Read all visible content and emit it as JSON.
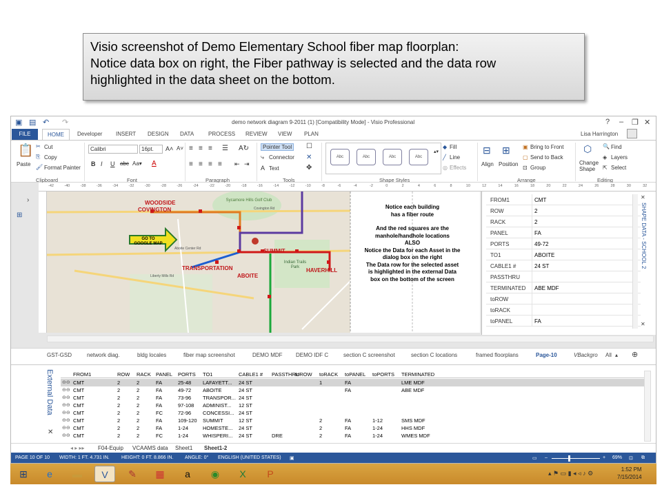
{
  "caption": {
    "line1": "Visio screenshot of Demo Elementary School fiber map floorplan:",
    "line2": "Notice data box on right, the Fiber pathway is selected and the data row",
    "line3": "highlighted in the data sheet on the bottom."
  },
  "titlebar": {
    "title": "demo network diagram 9-2011 (1)  [Compatibility Mode] - Visio Professional",
    "help": "?"
  },
  "tabs": [
    "Developer",
    "INSERT",
    "DESIGN",
    "DATA",
    "PROCESS",
    "REVIEW",
    "VIEW",
    "PLAN"
  ],
  "tab_file": "FILE",
  "tab_home": "HOME",
  "user": "Lisa Harrington",
  "ribbon": {
    "paste": "Paste",
    "cut": "Cut",
    "copy": "Copy",
    "format_painter": "Format Painter",
    "clipboard_label": "Clipboard",
    "font_name": "Calibri",
    "font_size": "16pt.",
    "font_label": "Font",
    "paragraph_label": "Paragraph",
    "pointer_tool": "Pointer Tool",
    "connector": "Connector",
    "text": "Text",
    "tools_label": "Tools",
    "shape_style_sample": "Abc",
    "fill": "Fill",
    "line": "Line",
    "effects": "Effects",
    "shape_styles_label": "Shape Styles",
    "align": "Align",
    "position": "Position",
    "bring_to_front": "Bring to Front",
    "send_to_back": "Send to Back",
    "group": "Group",
    "arrange_label": "Arrange",
    "change_shape": "Change Shape",
    "find": "Find",
    "layers": "Layers",
    "select": "Select",
    "editing_label": "Editing"
  },
  "ruler_ticks": [
    "-42",
    "-40",
    "-38",
    "-36",
    "-34",
    "-32",
    "-30",
    "-28",
    "-26",
    "-24",
    "-22",
    "-20",
    "-18",
    "-16",
    "-14",
    "-12",
    "-10",
    "-8",
    "-6",
    "-4",
    "-2",
    "0",
    "2",
    "4",
    "6",
    "8",
    "10",
    "12",
    "14",
    "16",
    "18",
    "20",
    "22",
    "24",
    "26",
    "28",
    "30",
    "32",
    "34"
  ],
  "map": {
    "labels": {
      "woodside": "WOODSIDE",
      "covington": "COVINGTON",
      "go_to_google_map": "GO TO GOOGLE MAP",
      "transportation": "TRANSPORTATION",
      "aboite": "ABOITE",
      "summit": "SUMMIT",
      "haverhill": "HAVERHILL",
      "golf_club": "Sycamore Hills Golf Club",
      "covington_rd": "Covington Rd",
      "aboite_center_rd": "Aboite Center Rd",
      "liberty_mills_rd": "Liberty Mills Rd",
      "indian_trails_park": "Indian Trails Park"
    },
    "notes": [
      "Notice each building",
      "has a fiber route",
      "",
      "And the red squares are the",
      "manhole/handhole locations",
      "ALSO",
      "Notice the Data for each Asset in the",
      "dialog box on the right",
      "The Data row for the selected asset",
      "is highlighted in the external Data",
      "box on the bottom of the screen"
    ]
  },
  "shape_data": {
    "title": "SHAPE DATA - SCHOOL 2",
    "rows": [
      {
        "k": "FROM1",
        "v": "CMT"
      },
      {
        "k": "ROW",
        "v": "2"
      },
      {
        "k": "RACK",
        "v": "2"
      },
      {
        "k": "PANEL",
        "v": "FA"
      },
      {
        "k": "PORTS",
        "v": "49-72"
      },
      {
        "k": "TO1",
        "v": "ABOITE"
      },
      {
        "k": "CABLE1 #",
        "v": "24 ST"
      },
      {
        "k": "PASSTHRU",
        "v": ""
      },
      {
        "k": "TERMINATED",
        "v": "ABE MDF"
      },
      {
        "k": "toROW",
        "v": ""
      },
      {
        "k": "toRACK",
        "v": ""
      },
      {
        "k": "toPANEL",
        "v": "FA"
      }
    ]
  },
  "page_tabs": [
    "GST-GSD",
    "network diag.",
    "bldg locales",
    "fiber map screenshot",
    "DEMO MDF",
    "DEMO IDF C",
    "section C screenshot",
    "section C locations",
    "framed floorplans",
    "Page-10",
    "VBackgro",
    "All"
  ],
  "external_data": {
    "label": "External Data",
    "columns": [
      "FROM1",
      "ROW",
      "RACK",
      "PANEL",
      "PORTS",
      "TO1",
      "CABLE1 #",
      "PASSTHRU",
      "toROW",
      "toRACK",
      "toPANEL",
      "toPORTS",
      "TERMINATED"
    ],
    "rows": [
      [
        "CMT",
        "2",
        "2",
        "FA",
        "25-48",
        "LAFAYETT...",
        "24 ST",
        "",
        "",
        "1",
        "FA",
        "",
        "LME MDF"
      ],
      [
        "CMT",
        "2",
        "2",
        "FA",
        "49-72",
        "ABOITE",
        "24 ST",
        "",
        "",
        "",
        "FA",
        "",
        "ABE MDF"
      ],
      [
        "CMT",
        "2",
        "2",
        "FA",
        "73-96",
        "TRANSPOR...",
        "24 ST",
        "",
        "",
        "",
        "",
        "",
        ""
      ],
      [
        "CMT",
        "2",
        "2",
        "FA",
        "97-108",
        "ADMINIST...",
        "12 ST",
        "",
        "",
        "",
        "",
        "",
        ""
      ],
      [
        "CMT",
        "2",
        "2",
        "FC",
        "72-96",
        "CONCESSI...",
        "24 ST",
        "",
        "",
        "",
        "",
        "",
        ""
      ],
      [
        "CMT",
        "2",
        "2",
        "FA",
        "109-120",
        "SUMMIT",
        "12 ST",
        "",
        "",
        "2",
        "FA",
        "1-12",
        "SMS MDF"
      ],
      [
        "CMT",
        "2",
        "2",
        "FA",
        "1-24",
        "HOMESTE...",
        "24 ST",
        "",
        "",
        "2",
        "FA",
        "1-24",
        "HHS MDF"
      ],
      [
        "CMT",
        "2",
        "2",
        "FC",
        "1-24",
        "WHISPERI...",
        "24 ST",
        "DRE",
        "",
        "2",
        "FA",
        "1-24",
        "WMES MDF"
      ]
    ]
  },
  "sheet_tabs": [
    "F04-Equip",
    "VCAAMS data",
    "Sheet1",
    "Sheet1-2"
  ],
  "status": {
    "page": "PAGE 10 OF 10",
    "width": "WIDTH: 1 FT. 4.731 IN.",
    "height": "HEIGHT: 0 FT. 8.866 IN.",
    "angle": "ANGLE: 0°",
    "language": "ENGLISH (UNITED STATES)",
    "zoom": "69%"
  },
  "clock": {
    "time": "1:52 PM",
    "date": "7/15/2014"
  }
}
